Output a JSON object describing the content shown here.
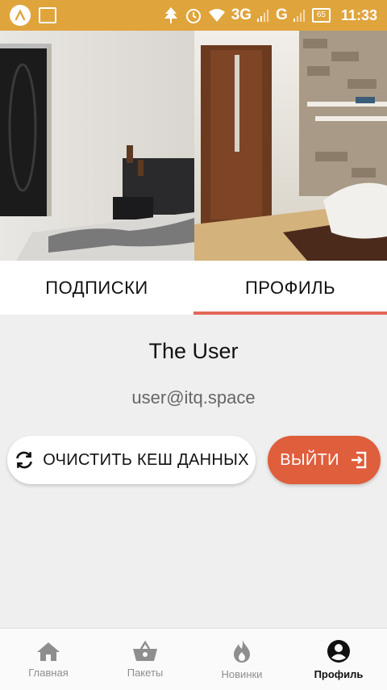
{
  "status_bar": {
    "network_3g": "3G",
    "network_g": "G",
    "battery": "65",
    "time": "11:33"
  },
  "tabs": [
    {
      "label": "ПОДПИСКИ",
      "active": false
    },
    {
      "label": "ПРОФИЛЬ",
      "active": true
    }
  ],
  "profile": {
    "name": "The User",
    "email": "user@itq.space"
  },
  "actions": {
    "clear_cache_label": "ОЧИСТИТЬ КЕШ ДАННЫХ",
    "logout_label": "ВЫЙТИ"
  },
  "bottom_nav": [
    {
      "label": "Главная",
      "icon": "home-icon",
      "active": false
    },
    {
      "label": "Пакеты",
      "icon": "basket-icon",
      "active": false
    },
    {
      "label": "Новинки",
      "icon": "flame-icon",
      "active": false
    },
    {
      "label": "Профиль",
      "icon": "account-circle-icon",
      "active": true
    }
  ],
  "colors": {
    "status_bar": "#e0a43c",
    "tab_indicator": "#e4685a",
    "logout_button": "#df5e3c",
    "background": "#efefef"
  }
}
